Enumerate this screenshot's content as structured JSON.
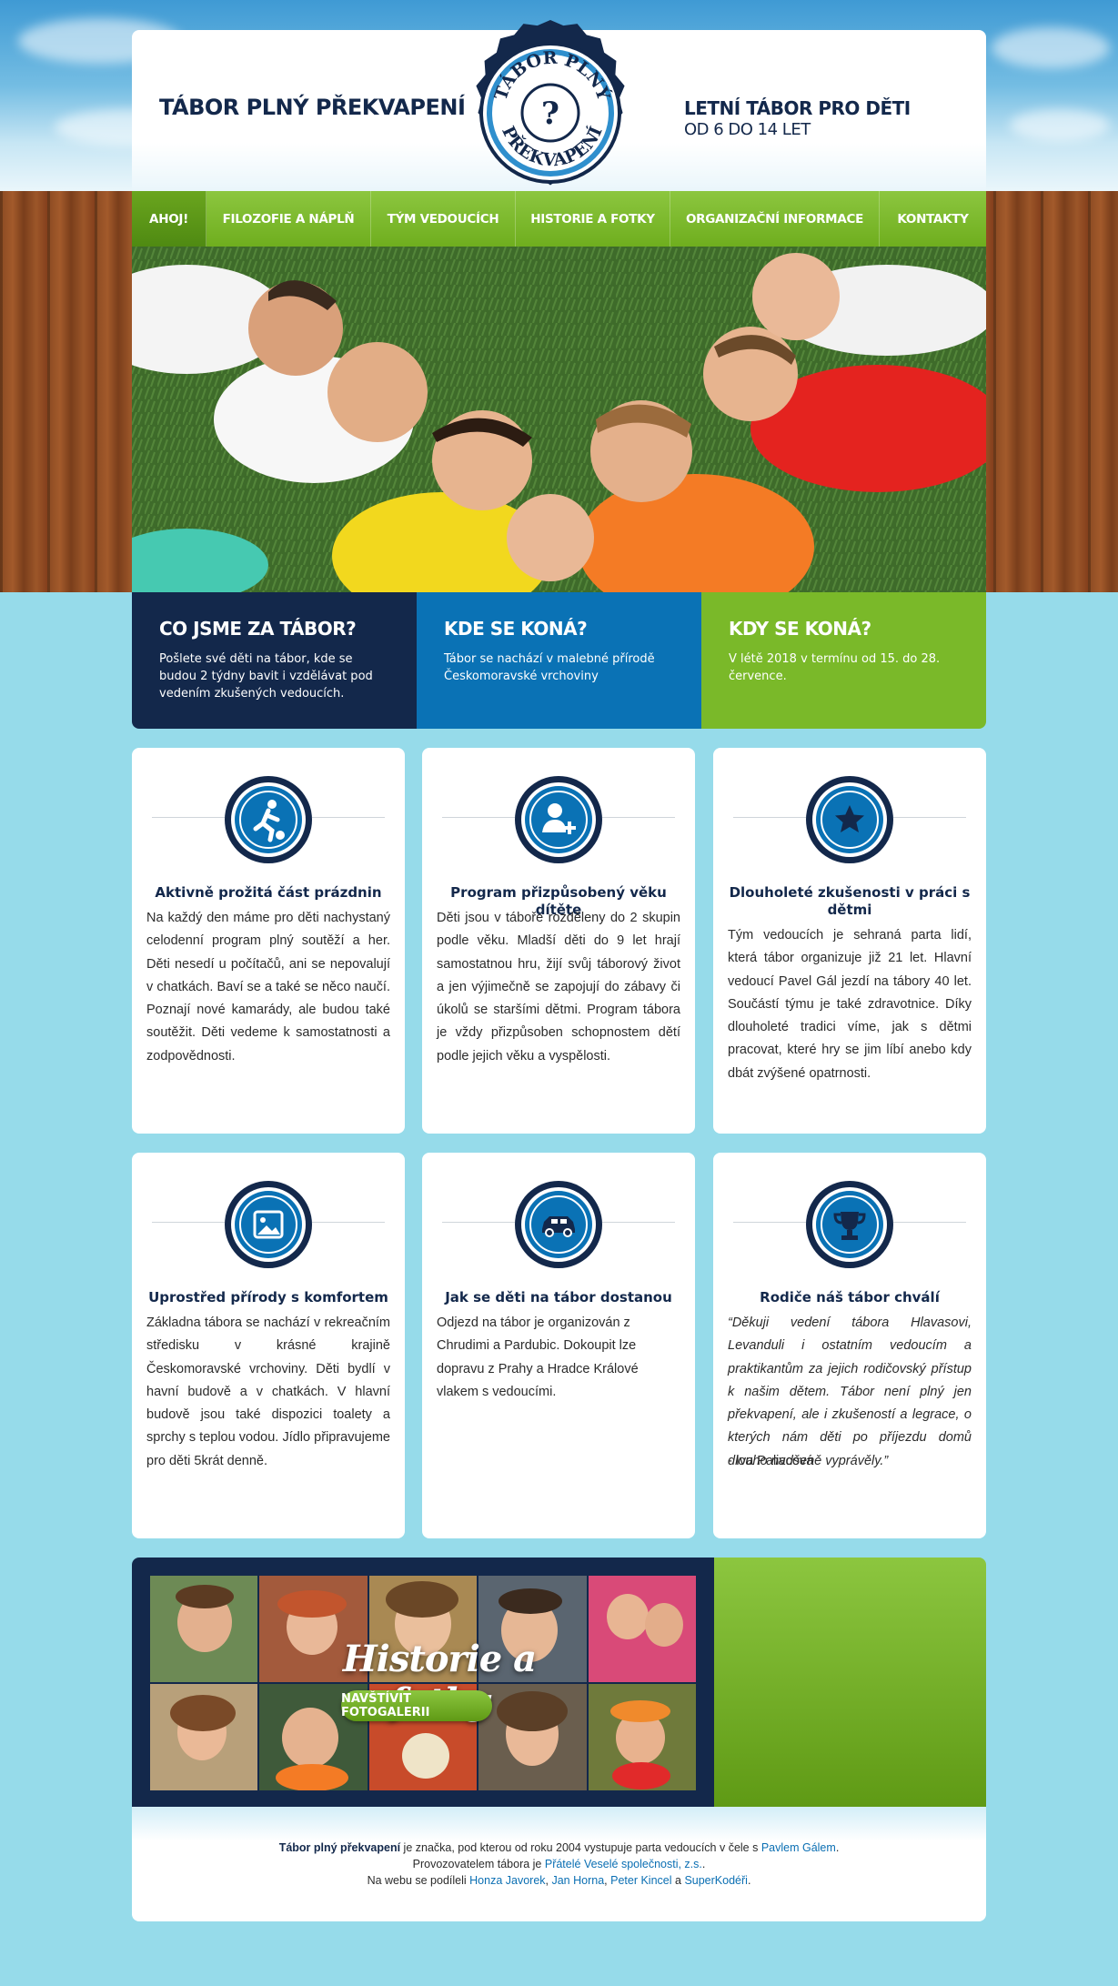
{
  "header": {
    "site_title": "TÁBOR PLNÝ PŘEKVAPENÍ",
    "logo_top": "TÁBOR PLNÝ",
    "logo_bottom": "PŘEKVAPENÍ",
    "logo_mark": "?",
    "tagline_1": "LETNÍ TÁBOR PRO DĚTI",
    "tagline_2": "OD 6 DO 14 LET"
  },
  "nav": {
    "items": [
      {
        "label": "AHOJ!"
      },
      {
        "label": "FILOZOFIE A NÁPLŇ"
      },
      {
        "label": "TÝM VEDOUCÍCH"
      },
      {
        "label": "HISTORIE A FOTKY"
      },
      {
        "label": "ORGANIZAČNÍ INFORMACE"
      },
      {
        "label": "KONTAKTY"
      }
    ]
  },
  "info": [
    {
      "title": "CO JSME ZA TÁBOR?",
      "text": "Pošlete své děti na tábor, kde se budou 2 týdny bavit i vzdělávat pod vedením zkušených vedoucích.",
      "color": "#13284b"
    },
    {
      "title": "KDE SE KONÁ?",
      "text": "Tábor se nachází v malebné přírodě Českomoravské vrchoviny",
      "color": "#0a72b5"
    },
    {
      "title": "KDY SE KONÁ?",
      "text": "V létě 2018 v termínu od 15. do 28. července.",
      "color": "#7ab929"
    }
  ],
  "features": [
    {
      "icon": "football-player-icon",
      "title": "Aktivně prožitá část prázdnin",
      "text": "Na každý den máme pro děti nachystaný celodenní program plný soutěží a her. Děti nesedí u počítačů, ani se nepovalují v chatkách. Baví se a také se něco naučí. Poznají nové kamarády, ale budou také soutěžit. Děti vedeme k samostatnosti a zodpovědnosti."
    },
    {
      "icon": "add-user-icon",
      "title": "Program přizpůsobený věku dítěte",
      "text": "Děti jsou v táboře rozděleny do 2 skupin podle věku. Mladší děti do 9 let hrají samostatnou hru, žijí svůj táborový život a jen výjimečně se zapojují do zábavy či úkolů se staršími dětmi. Program tábora je vždy přizpůsoben schopnostem dětí podle jejich věku a vyspělosti."
    },
    {
      "icon": "star-icon",
      "title": "Dlouholeté zkušenosti v práci s dětmi",
      "text": "Tým vedoucích je sehraná parta lidí, která tábor organizuje již 21 let. Hlavní vedoucí Pavel Gál jezdí na tábory 40 let. Součástí týmu je také zdravotnice. Díky dlouholeté tradici víme, jak s dětmi pracovat, které hry se jim líbí anebo kdy dbát zvýšené opatrnosti."
    },
    {
      "icon": "picture-icon",
      "title": "Uprostřed přírody s komfortem",
      "text": "Základna tábora se nachází v rekreačním středisku v krásné krajině Českomoravské vrchoviny. Děti bydlí v havní budově a v chatkách. V hlavní budově jsou také dispozici toalety a sprchy s teplou vodou. Jídlo připravujeme pro děti 5krát denně."
    },
    {
      "icon": "car-icon",
      "title": "Jak se děti na tábor dostanou",
      "text": "Odjezd na tábor je organizován z Chrudimi a Pardubic. Dokoupit lze dopravu z Prahy a Hradce Králové vlakem s vedoucími."
    },
    {
      "icon": "trophy-icon",
      "title": "Rodiče náš tábor chválí",
      "quote": "“Děkuji vedení tábora Hlavasovi, Levanduli i ostatním vedoucím a praktikantům za jejich rodičovský přístup k našim dětem. Tábor není plný jen překvapení, ale i zkušeností a legrace, o kterých nám děti po příjezdu domů dlouho nadšeně vyprávěly.”",
      "author": "- Iva Palivcová"
    }
  ],
  "gallery": {
    "title": "Historie a fotky",
    "button": "NAVŠTÍVIT FOTOGALERII"
  },
  "footer": {
    "line1_bold": "Tábor plný překvapení",
    "line1_text": " je značka, pod kterou od roku 2004 vystupuje parta vedoucích v čele s ",
    "line1_link": "Pavlem Gálem",
    "line1_end": ".",
    "line2_text": "Provozovatelem tábora je ",
    "line2_link": "Přátelé Veselé společnosti, z.s.",
    "line2_end": ".",
    "line3_text": "Na webu se podíleli ",
    "line3_link1": "Honza Javorek",
    "line3_sep1": ", ",
    "line3_link2": "Jan Horna",
    "line3_sep2": ", ",
    "line3_link3": "Peter Kincel",
    "line3_sep3": " a ",
    "line3_link4": "SuperKodéři",
    "line3_end": "."
  },
  "colors": {
    "navy": "#13284b",
    "blue": "#0a72b5",
    "green": "#7ab929",
    "page_bg": "#96dbea"
  }
}
